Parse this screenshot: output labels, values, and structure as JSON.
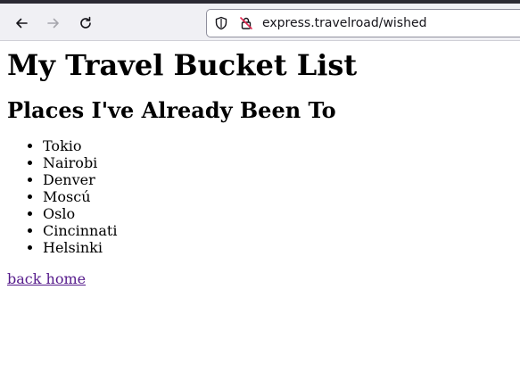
{
  "browser": {
    "url": "express.travelroad/wished",
    "icons": {
      "back": "arrow-left-icon",
      "forward": "arrow-right-icon",
      "reload": "reload-icon",
      "tracking": "shield-icon",
      "security": "insecure-lock-icon"
    }
  },
  "page": {
    "title": "My Travel Bucket List",
    "subtitle": "Places I've Already Been To",
    "places": [
      "Tokio",
      "Nairobi",
      "Denver",
      "Moscú",
      "Oslo",
      "Cincinnati",
      "Helsinki"
    ],
    "back_link": "back home"
  },
  "colors": {
    "link": "#551a8b",
    "text": "#000000",
    "toolbar": "#f0f0f4"
  }
}
